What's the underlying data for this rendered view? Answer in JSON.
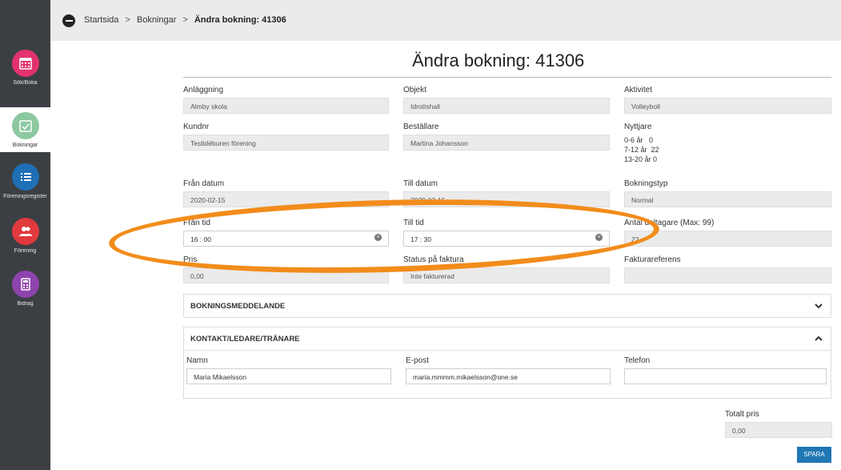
{
  "nav": {
    "items": [
      {
        "label": "Sök/Boka",
        "color": "#e2336f",
        "icon": "calendar-icon"
      },
      {
        "label": "Bokningar",
        "color": "#8cc8a0",
        "icon": "calendar-check-icon"
      },
      {
        "label": "Föreningsregister",
        "color": "#1e6fb5",
        "icon": "list-icon"
      },
      {
        "label": "Förening",
        "color": "#e03a3e",
        "icon": "users-icon"
      },
      {
        "label": "Bidrag",
        "color": "#8e44ad",
        "icon": "calculator-icon"
      }
    ]
  },
  "breadcrumb": {
    "items": [
      "Startsida",
      "Bokningar"
    ],
    "separator": ">",
    "current": "Ändra bokning: 41306"
  },
  "page": {
    "title": "Ändra bokning: 41306"
  },
  "form": {
    "anlaggning": {
      "label": "Anläggning",
      "value": "Almby skola"
    },
    "objekt": {
      "label": "Objekt",
      "value": "Idrottshall"
    },
    "aktivitet": {
      "label": "Aktivitet",
      "value": "Volleyboll"
    },
    "kundnr": {
      "label": "Kundnr",
      "value": "Testidéburen förening"
    },
    "bestallare": {
      "label": "Beställare",
      "value": "Martina Johansson"
    },
    "nyttjare": {
      "label": "Nyttjare",
      "groups": [
        {
          "age": "0-6 år",
          "count": "0"
        },
        {
          "age": "7-12 år",
          "count": "22"
        },
        {
          "age": "13-20 år",
          "count": "0"
        }
      ]
    },
    "fran_datum": {
      "label": "Från datum",
      "value": "2020-02-15"
    },
    "till_datum": {
      "label": "Till datum",
      "value": "2020-02-15"
    },
    "bokningstyp": {
      "label": "Bokningstyp",
      "value": "Normal"
    },
    "fran_tid": {
      "label": "Från tid",
      "value": "16 : 00"
    },
    "till_tid": {
      "label": "Till tid",
      "value": "17 : 30"
    },
    "antal_deltagare": {
      "label": "Antal deltagare (Max: 99)",
      "value": "22"
    },
    "pris": {
      "label": "Pris",
      "value": "0,00"
    },
    "status_faktura": {
      "label": "Status på faktura",
      "value": "Inte fakturerad"
    },
    "fakturareferens": {
      "label": "Fakturareferens",
      "value": ""
    }
  },
  "sections": {
    "bokningsmeddelande": {
      "title": "BOKNINGSMEDDELANDE",
      "state": "collapsed"
    },
    "kontakt": {
      "title": "KONTAKT/LEDARE/TRÄNARE",
      "state": "expanded",
      "namn": {
        "label": "Namn",
        "value": "Maria Mikaelsson"
      },
      "epost": {
        "label": "E-post",
        "value": "maria.mmmm.mikaelsson@one.se"
      },
      "telefon": {
        "label": "Telefon",
        "value": ""
      }
    }
  },
  "totals": {
    "label": "Totalt pris",
    "value": "0,00"
  },
  "actions": {
    "save_label": "SPARA"
  },
  "colors": {
    "accent": "#1f77b4",
    "highlight_ring": "#f28c1b",
    "sidebar": "#3b3f43"
  }
}
